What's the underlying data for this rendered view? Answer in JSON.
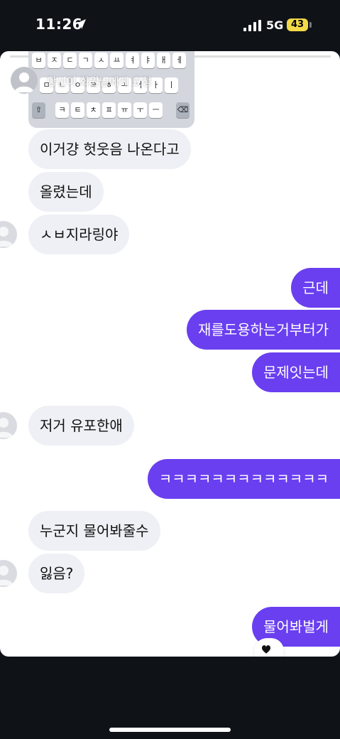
{
  "status_bar": {
    "time": "11:26",
    "network": "5G",
    "battery": "43"
  },
  "story": {
    "user_label": "당신이 회원님에게 요청",
    "progress": 1.0
  },
  "keyboard": {
    "row1": [
      "ㅂ",
      "ㅈ",
      "ㄷ",
      "ㄱ",
      "ㅅ",
      "ㅛ",
      "ㅕ",
      "ㅑ",
      "ㅐ",
      "ㅔ"
    ],
    "row2": [
      "ㅁ",
      "ㄴ",
      "ㅇ",
      "ㄹ",
      "ㅎ",
      "ㅗ",
      "ㅓ",
      "ㅏ",
      "ㅣ"
    ],
    "row3": [
      "ㅋ",
      "ㅌ",
      "ㅊ",
      "ㅍ",
      "ㅠ",
      "ㅜ",
      "ㅡ"
    ]
  },
  "messages": [
    {
      "side": "in",
      "text": "이거걍 헛웃음 나온다고"
    },
    {
      "side": "in",
      "text": "올렸는데"
    },
    {
      "side": "in",
      "text": "ㅅㅂ지라링야"
    },
    {
      "side": "out",
      "text": "근데"
    },
    {
      "side": "out",
      "text": "재를도용하는거부터가"
    },
    {
      "side": "out",
      "text": "문제잇는데"
    },
    {
      "side": "in",
      "text": "저거 유포한애"
    },
    {
      "side": "out",
      "text": "ㅋㅋㅋㅋㅋㅋㅋㅋㅋㅋㅋㅋㅋ"
    },
    {
      "side": "in",
      "text": "누군지 물어봐줄수"
    },
    {
      "side": "in",
      "text": "잃음?"
    },
    {
      "side": "out",
      "text": "물어봐벌게"
    }
  ],
  "reaction": {
    "icon": "heart-icon",
    "color": "#111111"
  },
  "colors": {
    "outgoing_bubble": "#6a3ff0",
    "incoming_bubble": "#eef0f5",
    "battery": "#f2d94a"
  }
}
